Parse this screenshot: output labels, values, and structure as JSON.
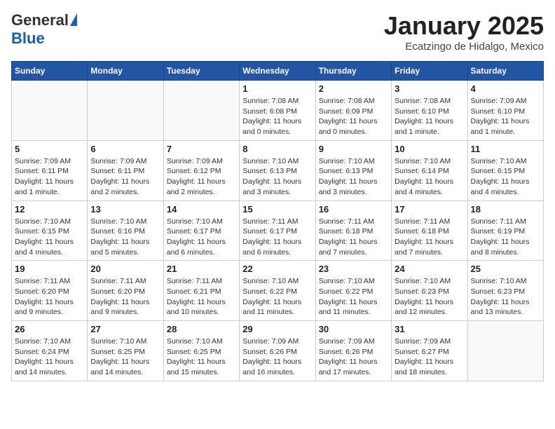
{
  "header": {
    "logo_general": "General",
    "logo_blue": "Blue",
    "month_title": "January 2025",
    "subtitle": "Ecatzingo de Hidalgo, Mexico"
  },
  "days_of_week": [
    "Sunday",
    "Monday",
    "Tuesday",
    "Wednesday",
    "Thursday",
    "Friday",
    "Saturday"
  ],
  "weeks": [
    [
      {
        "day": "",
        "info": ""
      },
      {
        "day": "",
        "info": ""
      },
      {
        "day": "",
        "info": ""
      },
      {
        "day": "1",
        "info": "Sunrise: 7:08 AM\nSunset: 6:08 PM\nDaylight: 11 hours\nand 0 minutes."
      },
      {
        "day": "2",
        "info": "Sunrise: 7:08 AM\nSunset: 6:09 PM\nDaylight: 11 hours\nand 0 minutes."
      },
      {
        "day": "3",
        "info": "Sunrise: 7:08 AM\nSunset: 6:10 PM\nDaylight: 11 hours\nand 1 minute."
      },
      {
        "day": "4",
        "info": "Sunrise: 7:09 AM\nSunset: 6:10 PM\nDaylight: 11 hours\nand 1 minute."
      }
    ],
    [
      {
        "day": "5",
        "info": "Sunrise: 7:09 AM\nSunset: 6:11 PM\nDaylight: 11 hours\nand 1 minute."
      },
      {
        "day": "6",
        "info": "Sunrise: 7:09 AM\nSunset: 6:11 PM\nDaylight: 11 hours\nand 2 minutes."
      },
      {
        "day": "7",
        "info": "Sunrise: 7:09 AM\nSunset: 6:12 PM\nDaylight: 11 hours\nand 2 minutes."
      },
      {
        "day": "8",
        "info": "Sunrise: 7:10 AM\nSunset: 6:13 PM\nDaylight: 11 hours\nand 3 minutes."
      },
      {
        "day": "9",
        "info": "Sunrise: 7:10 AM\nSunset: 6:13 PM\nDaylight: 11 hours\nand 3 minutes."
      },
      {
        "day": "10",
        "info": "Sunrise: 7:10 AM\nSunset: 6:14 PM\nDaylight: 11 hours\nand 4 minutes."
      },
      {
        "day": "11",
        "info": "Sunrise: 7:10 AM\nSunset: 6:15 PM\nDaylight: 11 hours\nand 4 minutes."
      }
    ],
    [
      {
        "day": "12",
        "info": "Sunrise: 7:10 AM\nSunset: 6:15 PM\nDaylight: 11 hours\nand 4 minutes."
      },
      {
        "day": "13",
        "info": "Sunrise: 7:10 AM\nSunset: 6:16 PM\nDaylight: 11 hours\nand 5 minutes."
      },
      {
        "day": "14",
        "info": "Sunrise: 7:10 AM\nSunset: 6:17 PM\nDaylight: 11 hours\nand 6 minutes."
      },
      {
        "day": "15",
        "info": "Sunrise: 7:11 AM\nSunset: 6:17 PM\nDaylight: 11 hours\nand 6 minutes."
      },
      {
        "day": "16",
        "info": "Sunrise: 7:11 AM\nSunset: 6:18 PM\nDaylight: 11 hours\nand 7 minutes."
      },
      {
        "day": "17",
        "info": "Sunrise: 7:11 AM\nSunset: 6:18 PM\nDaylight: 11 hours\nand 7 minutes."
      },
      {
        "day": "18",
        "info": "Sunrise: 7:11 AM\nSunset: 6:19 PM\nDaylight: 11 hours\nand 8 minutes."
      }
    ],
    [
      {
        "day": "19",
        "info": "Sunrise: 7:11 AM\nSunset: 6:20 PM\nDaylight: 11 hours\nand 9 minutes."
      },
      {
        "day": "20",
        "info": "Sunrise: 7:11 AM\nSunset: 6:20 PM\nDaylight: 11 hours\nand 9 minutes."
      },
      {
        "day": "21",
        "info": "Sunrise: 7:11 AM\nSunset: 6:21 PM\nDaylight: 11 hours\nand 10 minutes."
      },
      {
        "day": "22",
        "info": "Sunrise: 7:10 AM\nSunset: 6:22 PM\nDaylight: 11 hours\nand 11 minutes."
      },
      {
        "day": "23",
        "info": "Sunrise: 7:10 AM\nSunset: 6:22 PM\nDaylight: 11 hours\nand 11 minutes."
      },
      {
        "day": "24",
        "info": "Sunrise: 7:10 AM\nSunset: 6:23 PM\nDaylight: 11 hours\nand 12 minutes."
      },
      {
        "day": "25",
        "info": "Sunrise: 7:10 AM\nSunset: 6:23 PM\nDaylight: 11 hours\nand 13 minutes."
      }
    ],
    [
      {
        "day": "26",
        "info": "Sunrise: 7:10 AM\nSunset: 6:24 PM\nDaylight: 11 hours\nand 14 minutes."
      },
      {
        "day": "27",
        "info": "Sunrise: 7:10 AM\nSunset: 6:25 PM\nDaylight: 11 hours\nand 14 minutes."
      },
      {
        "day": "28",
        "info": "Sunrise: 7:10 AM\nSunset: 6:25 PM\nDaylight: 11 hours\nand 15 minutes."
      },
      {
        "day": "29",
        "info": "Sunrise: 7:09 AM\nSunset: 6:26 PM\nDaylight: 11 hours\nand 16 minutes."
      },
      {
        "day": "30",
        "info": "Sunrise: 7:09 AM\nSunset: 6:26 PM\nDaylight: 11 hours\nand 17 minutes."
      },
      {
        "day": "31",
        "info": "Sunrise: 7:09 AM\nSunset: 6:27 PM\nDaylight: 11 hours\nand 18 minutes."
      },
      {
        "day": "",
        "info": ""
      }
    ]
  ]
}
